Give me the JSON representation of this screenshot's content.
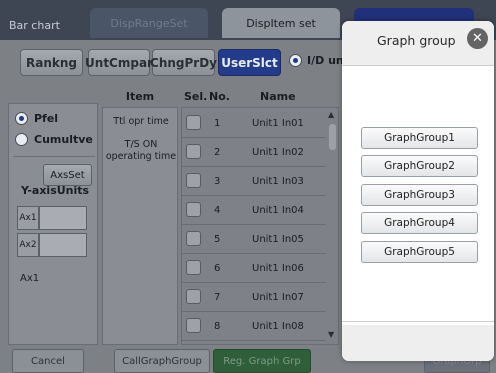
{
  "tabs": {
    "title": "Bar chart",
    "range": "DispRangeSet",
    "item": "DispItem set",
    "close": "✕"
  },
  "toolbar": {
    "ranking": "Rankng",
    "untcmpar": "UntCmpar",
    "chngprdy": "ChngPrDy",
    "userslct": "UserSlct",
    "id_unit": "I/D unit"
  },
  "left": {
    "pfel": "Pfel",
    "cumultve": "Cumultve",
    "yaxis": "Y-axisUnits",
    "ax1": "Ax1",
    "ax2": "Ax2",
    "ax1_label": "Ax1",
    "axsset": "AxsSet"
  },
  "item": {
    "header": "Item",
    "line1": "Ttl opr time",
    "line2a": "T/S ON",
    "line2b": "operating time"
  },
  "table": {
    "col_sel": "Sel.",
    "col_no": "No.",
    "col_name": "Name",
    "rows": [
      {
        "no": "1",
        "name": "Unit1 In01"
      },
      {
        "no": "2",
        "name": "Unit1 In02"
      },
      {
        "no": "3",
        "name": "Unit1 In03"
      },
      {
        "no": "4",
        "name": "Unit1 In04"
      },
      {
        "no": "5",
        "name": "Unit1 In05"
      },
      {
        "no": "6",
        "name": "Unit1 In06"
      },
      {
        "no": "7",
        "name": "Unit1 In07"
      },
      {
        "no": "8",
        "name": "Unit1 In08"
      }
    ]
  },
  "bottom": {
    "cancel": "Cancel",
    "callgraph": "CallGraphGroup",
    "reg": "Reg. Graph Grp",
    "right": "GraphGrp"
  },
  "dialog": {
    "title": "Graph group",
    "close_icon": "✕",
    "groups": [
      "GraphGroup1",
      "GraphGroup2",
      "GraphGroup3",
      "GraphGroup4",
      "GraphGroup5"
    ]
  },
  "colors": {
    "selected_blue": "#233b8a",
    "dialog_bg": "#ffffff",
    "reg_green": "#2f5e3a"
  }
}
